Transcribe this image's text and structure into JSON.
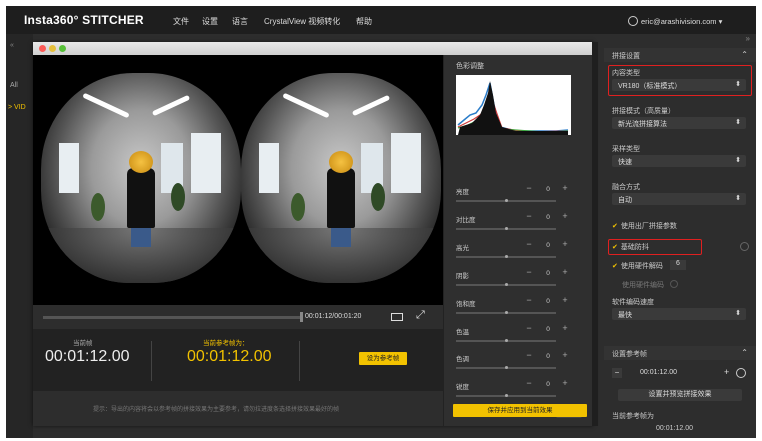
{
  "app": {
    "brand": "Insta360° STITCHER",
    "menu": [
      "文件",
      "设置",
      "语言",
      "CrystalView 视频转化",
      "帮助"
    ],
    "user_email": "eric@arashivision.com"
  },
  "left_strip": {
    "collapse": "«",
    "all_label": "All",
    "item": "> VID"
  },
  "preview": {
    "current_time": "00:01:12/00:01:20"
  },
  "frames": {
    "current_frame_label": "当前帧",
    "current_frame_value": "00:01:12.00",
    "ref_frame_label": "当前参考帧为：",
    "ref_frame_value": "00:01:12.00",
    "set_ref_button": "设为参考帧"
  },
  "hint": "提示：导出的内容将会以参考帧的拼接效果为主要参考，请勿拉进度条选择拼接效果最好的帧",
  "color_panel": {
    "title": "色彩调整",
    "rows": [
      {
        "label": "亮度",
        "value": "0"
      },
      {
        "label": "对比度",
        "value": "0"
      },
      {
        "label": "高光",
        "value": "0"
      },
      {
        "label": "阴影",
        "value": "0"
      },
      {
        "label": "饱和度",
        "value": "0"
      },
      {
        "label": "色温",
        "value": "0"
      },
      {
        "label": "色调",
        "value": "0"
      },
      {
        "label": "锐度",
        "value": "0"
      }
    ],
    "save_button": "保存",
    "apply_button": "保存并应用到当前效果"
  },
  "right_panel": {
    "expand": "»",
    "stitch_settings_title": "拼接设置",
    "content_type_label": "内容类型",
    "content_type_value": "VR180（标准模式）",
    "stitch_mode_label": "拼接模式（高质量）",
    "stitch_mode_value": "新光流拼接算法",
    "sampling_label": "采样类型",
    "sampling_value": "快速",
    "blend_label": "融合方式",
    "blend_value": "自动",
    "use_factory_params": "使用出厂拼接参数",
    "gyro_stabilization": "基础防抖",
    "use_hw_decode": "使用硬件解码",
    "hw_decode_count": "6",
    "use_hw_encode": "使用硬件编码",
    "sw_decode_speed_label": "软件编码速度",
    "sw_decode_speed_value": "最快",
    "ref_frame_title": "设置参考帧",
    "ref_frame_time": "00:01:12.00",
    "set_stitch_preview_button": "设置并预览拼接效果",
    "current_ref_label": "当前参考帧为",
    "current_ref_value": "00:01:12.00"
  },
  "colors": {
    "accent": "#f2c200",
    "highlight_box": "#e02020"
  }
}
